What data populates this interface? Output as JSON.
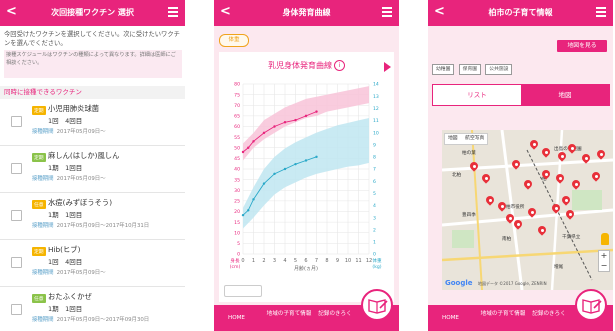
{
  "screen1": {
    "back": "<",
    "title": "次回接種ワクチン 選択",
    "intro": "今回受けたワクチンを選択してください。次に受けたいワクチンを選んでください。",
    "note": "接種スケジュールはワクチンの種類によって異なります。詳細は医師にご相談ください。",
    "section": "同時に接種できるワクチン",
    "period_label": "接種期間",
    "vaccines": [
      {
        "tag": "定期",
        "tag_class": "inact",
        "name": "小児用肺炎球菌",
        "dose": "1回　4回目",
        "period": "2017年05月09日〜"
      },
      {
        "tag": "定期",
        "tag_class": "live",
        "name": "麻しん(はしか)風しん",
        "dose": "1期　1回目",
        "period": "2017年05月09日〜"
      },
      {
        "tag": "任意",
        "tag_class": "inact",
        "name": "水痘(みずぼうそう)",
        "dose": "1期　1回目",
        "period": "2017年05月09日〜2017年10月31日"
      },
      {
        "tag": "定期",
        "tag_class": "inact",
        "name": "Hib(ヒブ)",
        "dose": "1回　4回目",
        "period": "2017年05月09日〜"
      },
      {
        "tag": "任意",
        "tag_class": "live",
        "name": "おたふくかぜ",
        "dose": "1期　1回目",
        "period": "2017年05月09日〜2017年09月30日"
      }
    ]
  },
  "screen2": {
    "back": "<",
    "title": "身体発育曲線",
    "badge": "体重",
    "chart_title": "乳児身体発育曲線",
    "info_icon": "i",
    "nav": [
      {
        "label": "HOME"
      },
      {
        "label": "地域の子育て情報"
      },
      {
        "label": "記録のきろく"
      }
    ]
  },
  "chart_data": {
    "type": "line",
    "title": "乳児身体発育曲線",
    "x": [
      0,
      1,
      2,
      3,
      4,
      5,
      6,
      7,
      8,
      9,
      10,
      11,
      12
    ],
    "xlabel": "月齢(ヵ月)",
    "ylabel_left": "身長(cm)",
    "ylabel_right": "体重(kg)",
    "xlim": [
      0,
      12
    ],
    "ylim_left": [
      0,
      80
    ],
    "ylim_right": [
      0,
      14
    ],
    "left_ticks": [
      80,
      75,
      70,
      65,
      60,
      55,
      50,
      45,
      40,
      35,
      30,
      25,
      20,
      15,
      10,
      5,
      0
    ],
    "right_ticks": [
      14,
      13,
      12,
      11,
      10,
      9,
      8,
      7,
      6,
      5,
      4,
      3,
      2,
      1,
      0
    ],
    "height_band_lower": [
      44,
      50,
      54,
      57,
      60,
      62,
      64,
      65,
      67,
      68,
      69,
      70,
      71
    ],
    "height_band_upper": [
      52,
      57,
      63,
      66,
      69,
      71,
      73,
      74,
      75,
      76,
      77,
      78,
      79
    ],
    "weight_band_lower": [
      2.1,
      3.0,
      4.0,
      4.9,
      5.5,
      5.9,
      6.3,
      6.6,
      6.8,
      7.0,
      7.2,
      7.3,
      7.5
    ],
    "weight_band_upper": [
      3.8,
      5.5,
      7.0,
      8.0,
      8.7,
      9.2,
      9.6,
      10.0,
      10.3,
      10.6,
      10.8,
      11.0,
      11.2
    ],
    "series": [
      {
        "name": "身長",
        "color": "#e8247c",
        "x": [
          0,
          0.5,
          1,
          2,
          3,
          4,
          5,
          6,
          7
        ],
        "values": [
          48,
          50,
          53,
          57,
          60,
          62,
          63,
          65,
          67
        ]
      },
      {
        "name": "体重",
        "color": "#2aa8c8",
        "x": [
          0,
          0.5,
          1,
          2,
          3,
          4,
          5,
          6,
          7
        ],
        "values": [
          3.2,
          3.6,
          4.5,
          5.8,
          6.6,
          7.0,
          7.4,
          7.7,
          8.0
        ]
      }
    ],
    "grid": true,
    "colors": {
      "height_band": "#f8c3d8",
      "weight_band": "#bfe6f1"
    }
  },
  "screen3": {
    "back": "<",
    "title": "柏市の子育て情報",
    "map_button": "地図を見る",
    "filters": [
      "幼稚園",
      "保育園",
      "公共施設"
    ],
    "tabs": {
      "list": "リスト",
      "map": "地図"
    },
    "map_type": [
      "地図",
      "航空写真"
    ],
    "map_labels": [
      {
        "text": "柏の葉",
        "pos": [
          20,
          20
        ]
      },
      {
        "text": "出島の育児園",
        "pos": [
          112,
          16
        ]
      },
      {
        "text": "北柏",
        "pos": [
          10,
          42
        ]
      },
      {
        "text": "柏",
        "pos": [
          100,
          46
        ]
      },
      {
        "text": "豊四季",
        "pos": [
          20,
          82
        ]
      },
      {
        "text": "柏市役所",
        "pos": [
          64,
          74
        ]
      },
      {
        "text": "南柏",
        "pos": [
          60,
          106
        ]
      },
      {
        "text": "千葉県立",
        "pos": [
          120,
          104
        ]
      },
      {
        "text": "増尾",
        "pos": [
          112,
          134
        ]
      }
    ],
    "google": "Google",
    "map_credit": "地図データ ©2017 Google, ZENRIN",
    "nav": [
      {
        "label": "HOME"
      },
      {
        "label": "地域の子育て情報"
      },
      {
        "label": "記録のきろく"
      }
    ]
  }
}
